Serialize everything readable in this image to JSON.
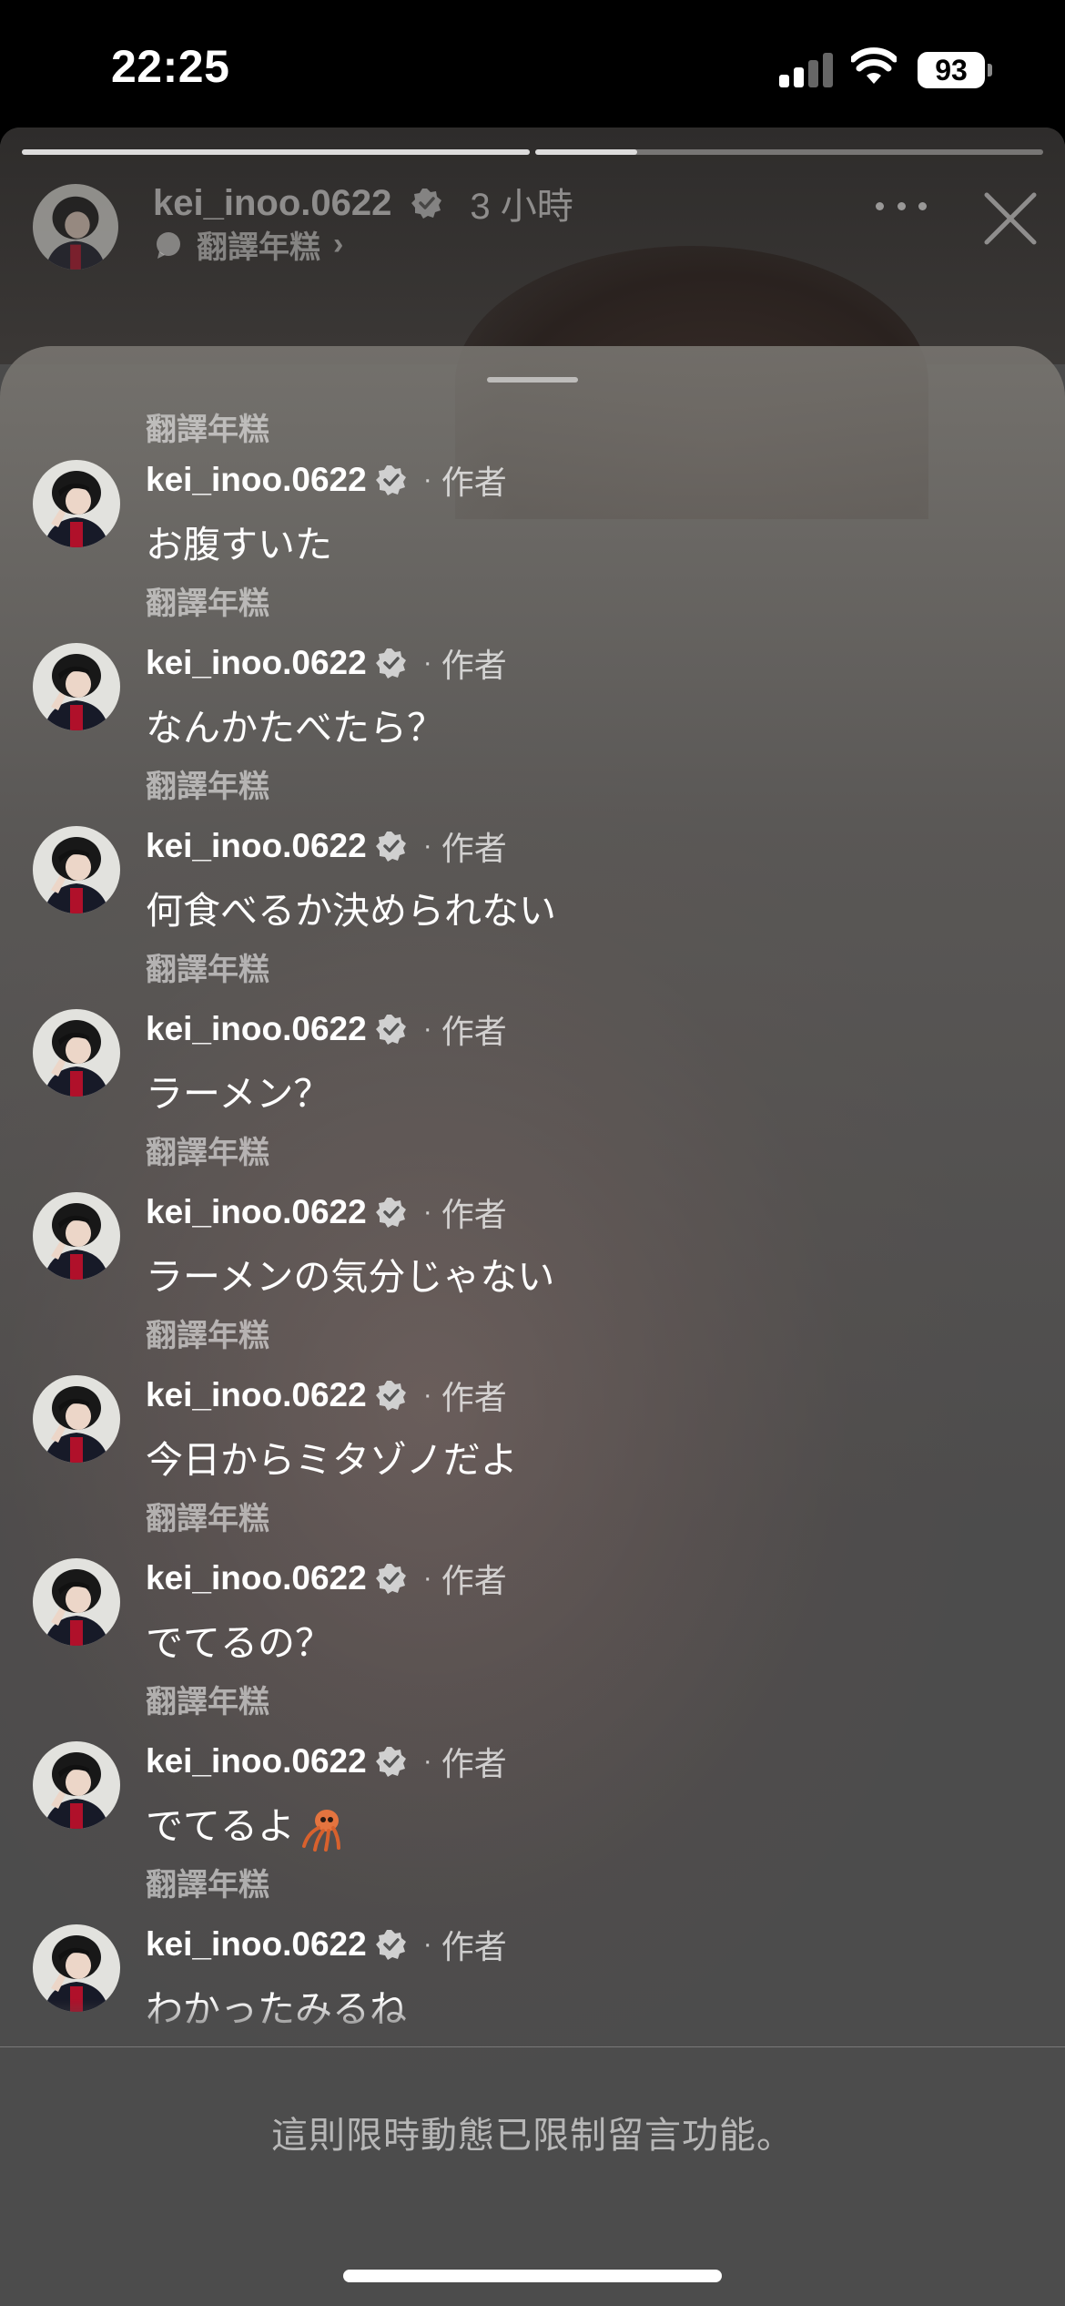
{
  "status_bar": {
    "time": "22:25",
    "battery": "93"
  },
  "story": {
    "username": "kei_inoo.0622",
    "posted": "3 小時",
    "translate_label": "翻譯年糕",
    "progress": [
      1.0,
      0.2
    ]
  },
  "comments": {
    "top_partial_translate": "翻譯年糕",
    "items": [
      {
        "username": "kei_inoo.0622",
        "dot": "·",
        "author_label": "作者",
        "text": "お腹すいた",
        "translate": "翻譯年糕"
      },
      {
        "username": "kei_inoo.0622",
        "dot": "·",
        "author_label": "作者",
        "text": "なんかたべたら？",
        "translate": "翻譯年糕"
      },
      {
        "username": "kei_inoo.0622",
        "dot": "·",
        "author_label": "作者",
        "text": "何食べるか決められない",
        "translate": "翻譯年糕"
      },
      {
        "username": "kei_inoo.0622",
        "dot": "·",
        "author_label": "作者",
        "text": "ラーメン？",
        "translate": "翻譯年糕"
      },
      {
        "username": "kei_inoo.0622",
        "dot": "·",
        "author_label": "作者",
        "text": "ラーメンの気分じゃない",
        "translate": "翻譯年糕"
      },
      {
        "username": "kei_inoo.0622",
        "dot": "·",
        "author_label": "作者",
        "text": "今日からミタゾノだよ",
        "translate": "翻譯年糕"
      },
      {
        "username": "kei_inoo.0622",
        "dot": "·",
        "author_label": "作者",
        "text": "でてるの？",
        "translate": "翻譯年糕"
      },
      {
        "username": "kei_inoo.0622",
        "dot": "·",
        "author_label": "作者",
        "text": "でてるよ",
        "emoji": "squid-emoji",
        "translate": "翻譯年糕"
      },
      {
        "username": "kei_inoo.0622",
        "dot": "·",
        "author_label": "作者",
        "text": "わかったみるね",
        "translate": "翻譯年糕"
      }
    ]
  },
  "footer": {
    "restricted_notice": "這則限時動態已限制留言功能。"
  },
  "colors": {
    "status_bar": "#000000",
    "sheet_top": "#78756f",
    "sheet_bottom": "#505050"
  }
}
